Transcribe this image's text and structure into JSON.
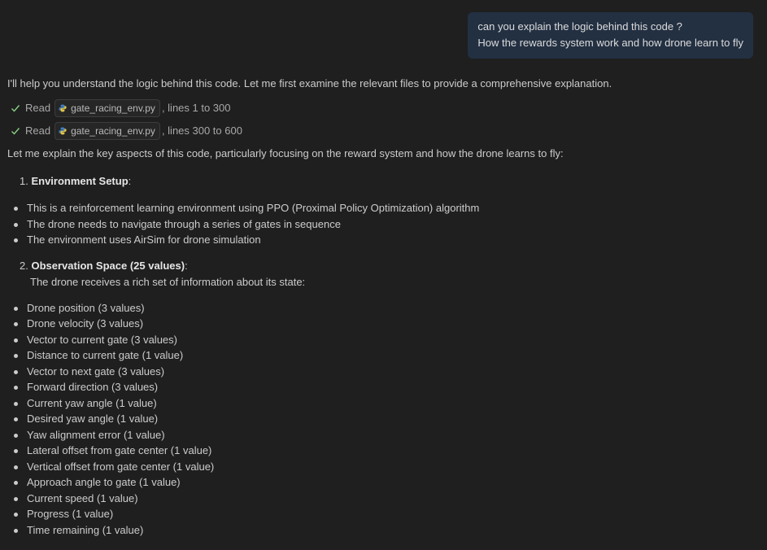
{
  "user_message": {
    "line1": "can you explain the logic behind this code ?",
    "line2": "How the rewards system work and how drone learn to fly"
  },
  "assistant": {
    "intro": "I'll help you understand the logic behind this code. Let me first examine the relevant files to provide a comprehensive explanation.",
    "tool_calls": [
      {
        "action": "Read",
        "file": "gate_racing_env.py",
        "range": ", lines 1 to 300"
      },
      {
        "action": "Read",
        "file": "gate_racing_env.py",
        "range": ", lines 300 to 600"
      }
    ],
    "lead": "Let me explain the key aspects of this code, particularly focusing on the reward system and how the drone learns to fly:",
    "section1": {
      "number": "1.",
      "title": "Environment Setup",
      "suffix": ":",
      "bullets": [
        "This is a reinforcement learning environment using PPO (Proximal Policy Optimization) algorithm",
        "The drone needs to navigate through a series of gates in sequence",
        "The environment uses AirSim for drone simulation"
      ]
    },
    "section2": {
      "number": "2.",
      "title": "Observation Space (25 values)",
      "suffix": ":",
      "subtitle": "The drone receives a rich set of information about its state:",
      "bullets": [
        "Drone position (3 values)",
        "Drone velocity (3 values)",
        "Vector to current gate (3 values)",
        "Distance to current gate (1 value)",
        "Vector to next gate (3 values)",
        "Forward direction (3 values)",
        "Current yaw angle (1 value)",
        "Desired yaw angle (1 value)",
        "Yaw alignment error (1 value)",
        "Lateral offset from gate center (1 value)",
        "Vertical offset from gate center (1 value)",
        "Approach angle to gate (1 value)",
        "Current speed (1 value)",
        "Progress (1 value)",
        "Time remaining (1 value)"
      ]
    }
  },
  "icons": {
    "check": "check-icon",
    "python": "python-file-icon"
  },
  "colors": {
    "background": "#1f1f1f",
    "user_bubble": "#233042",
    "check_green": "#89d185"
  }
}
